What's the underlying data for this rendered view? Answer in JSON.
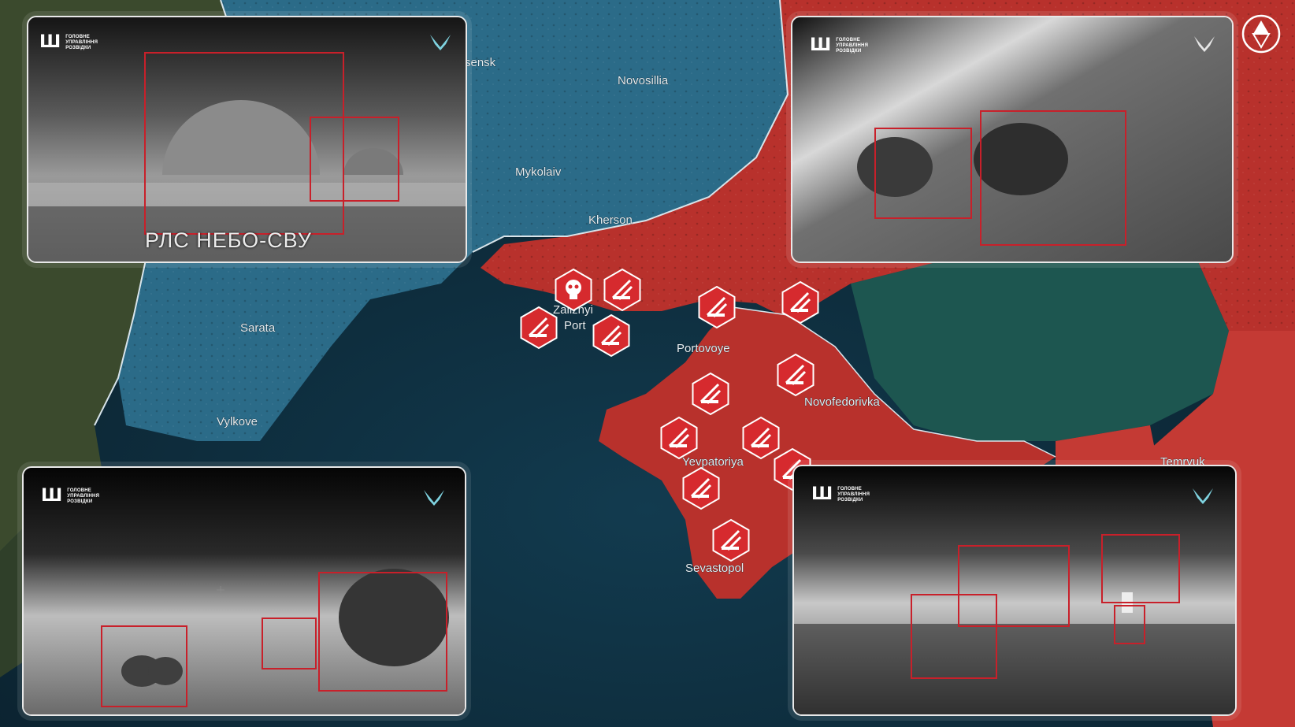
{
  "places": [
    {
      "id": "sensk",
      "label": "sensk"
    },
    {
      "id": "novosillia",
      "label": "Novosillia"
    },
    {
      "id": "mykolaiv",
      "label": "Mykolaiv"
    },
    {
      "id": "kherson",
      "label": "Kherson"
    },
    {
      "id": "sarata",
      "label": "Sarata"
    },
    {
      "id": "vylkove",
      "label": "Vylkove"
    },
    {
      "id": "zaliznyi-port",
      "label": "Zaliznyi\nPort"
    },
    {
      "id": "portovoye",
      "label": "Portovoye"
    },
    {
      "id": "novofedorivka",
      "label": "Novofedorivka"
    },
    {
      "id": "yevpatoriya",
      "label": "Yevpatoriya"
    },
    {
      "id": "sevastopol",
      "label": "Sevastopol"
    },
    {
      "id": "temryuk",
      "label": "Temryuk"
    }
  ],
  "insets": [
    {
      "id": "top-left",
      "caption": "РЛС НЕБО-СВУ",
      "brand_text": "ГОЛОВНЕ\nУПРАВЛІННЯ\nРОЗВІДКИ"
    },
    {
      "id": "top-right",
      "brand_text": "ГОЛОВНЕ\nУПРАВЛІННЯ\nРОЗВІДКИ"
    },
    {
      "id": "bottom-left",
      "brand_text": "ГОЛОВНЕ\nУПРАВЛІННЯ\nРОЗВІДКИ"
    },
    {
      "id": "bottom-right",
      "brand_text": "ГОЛОВНЕ\nУПРАВЛІННЯ\nРОЗВІДКИ"
    }
  ],
  "markers": [
    {
      "id": "m1",
      "type": "skull"
    },
    {
      "id": "m2",
      "type": "strike"
    },
    {
      "id": "m3",
      "type": "strike"
    },
    {
      "id": "m4",
      "type": "strike"
    },
    {
      "id": "m5",
      "type": "strike"
    },
    {
      "id": "m6",
      "type": "strike"
    },
    {
      "id": "m7",
      "type": "strike"
    },
    {
      "id": "m8",
      "type": "strike"
    },
    {
      "id": "m9",
      "type": "strike"
    },
    {
      "id": "m10",
      "type": "strike"
    },
    {
      "id": "m11",
      "type": "strike"
    },
    {
      "id": "m12",
      "type": "strike"
    },
    {
      "id": "m13",
      "type": "strike"
    },
    {
      "id": "m14",
      "type": "strike"
    }
  ],
  "colors": {
    "sea": "#0d2a38",
    "ukraine_controlled": "#2b6b88",
    "occupied": "#b8312c",
    "russia": "#c43a34",
    "azov": "#1f5a52",
    "marker": "#d62a2e",
    "frame_box": "#c8202a"
  },
  "icons": {
    "compass": "north-compass-icon",
    "agency": "trident-icon",
    "unit": "bird-emblem-icon"
  }
}
